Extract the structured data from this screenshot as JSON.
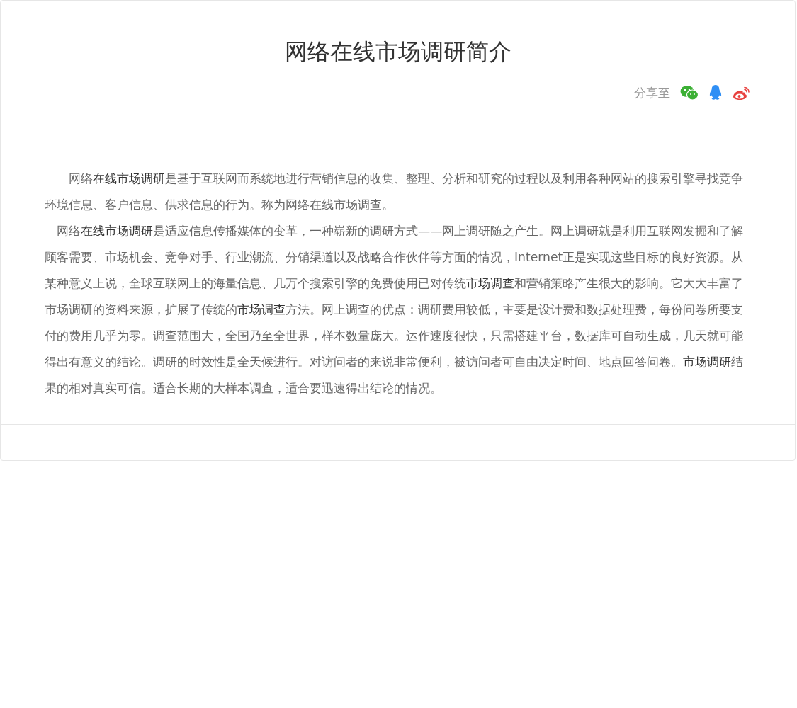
{
  "title": "网络在线市场调研简介",
  "share": {
    "label": "分享至",
    "icons": [
      {
        "kind": "chat"
      },
      {
        "kind": "penguin"
      },
      {
        "kind": "eye"
      }
    ]
  },
  "paragraphs": [
    {
      "segments": [
        {
          "text": "　　网络",
          "link": false
        },
        {
          "text": "在线市场调研",
          "link": true
        },
        {
          "text": "是基于互联网而系统地进行营销信息的收集、整理、分析和研究的过程以及利用各种网站的搜索引擎寻找竞争环境信息、客户信息、供求信息的行为。称为网络在线市场调查。",
          "link": false
        }
      ]
    },
    {
      "segments": [
        {
          "text": "　网络",
          "link": false
        },
        {
          "text": "在线市场调研",
          "link": true
        },
        {
          "text": "是适应信息传播媒体的变革，一种崭新的调研方式——网上调研随之产生。网上调研就是利用互联网发掘和了解顾客需要、市场机会、竞争对手、行业潮流、分销渠道以及战略合作伙伴等方面的情况，Internet正是实现这些目标的良好资源。从某种意义上说，全球互联网上的海量信息、几万个搜索引擎的免费使用已对传统",
          "link": false
        },
        {
          "text": "市场调查",
          "link": true
        },
        {
          "text": "和营销策略产生很大的影响。它大大丰富了市场调研的资料来源，扩展了传统的",
          "link": false
        },
        {
          "text": "市场调查",
          "link": true
        },
        {
          "text": "方法。网上调查的优点：调研费用较低，主要是设计费和数据处理费，每份问卷所要支付的费用几乎为零。调查范围大，全国乃至全世界，样本数量庞大。运作速度很快，只需搭建平台，数据库可自动生成，几天就可能得出有意义的结论。调研的时效性是全天候进行。对访问者的来说非常便利，被访问者可自由决定时间、地点回答问卷。",
          "link": false
        },
        {
          "text": "市场调研",
          "link": true
        },
        {
          "text": "结果的相对真实可信。适合长期的大样本调查，适合要迅速得出结论的情况。",
          "link": false
        }
      ]
    }
  ]
}
